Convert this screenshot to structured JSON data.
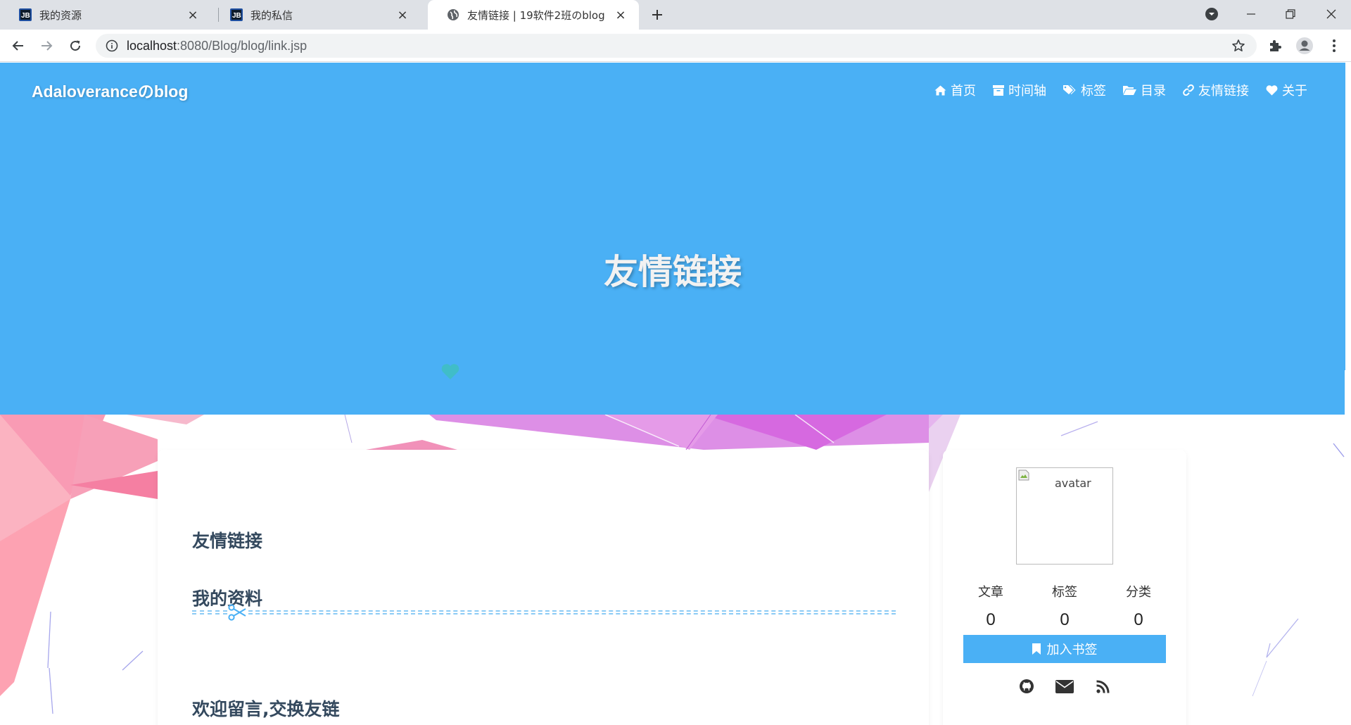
{
  "browser": {
    "tabs": [
      {
        "title": "我的资源",
        "active": false
      },
      {
        "title": "我的私信",
        "active": false
      },
      {
        "title": "友情链接 | 19软件2班のblog",
        "active": true
      }
    ],
    "url_host": "localhost",
    "url_path": ":8080/Blog/blog/link.jsp",
    "new_tab_glyph": "+",
    "close_glyph": "×",
    "favicon_text": "JB"
  },
  "site": {
    "brand": "Adaloveranceのblog",
    "nav": [
      {
        "label": "首页",
        "icon": "home-icon"
      },
      {
        "label": "时间轴",
        "icon": "archive-icon"
      },
      {
        "label": "标签",
        "icon": "tags-icon"
      },
      {
        "label": "目录",
        "icon": "folder-open-icon"
      },
      {
        "label": "友情链接",
        "icon": "link-icon"
      },
      {
        "label": "关于",
        "icon": "heart-icon"
      }
    ],
    "hero_title": "友情链接",
    "accent_color": "#4ab0f5"
  },
  "main": {
    "headings": [
      "友情链接",
      "我的资料",
      "欢迎留言,交换友链"
    ]
  },
  "sidebar": {
    "avatar_alt": "avatar",
    "stats": [
      {
        "label": "文章",
        "value": "0"
      },
      {
        "label": "标签",
        "value": "0"
      },
      {
        "label": "分类",
        "value": "0"
      }
    ],
    "bookmark_label": "加入书签",
    "socials": [
      "github-icon",
      "envelope-icon",
      "rss-icon"
    ]
  }
}
